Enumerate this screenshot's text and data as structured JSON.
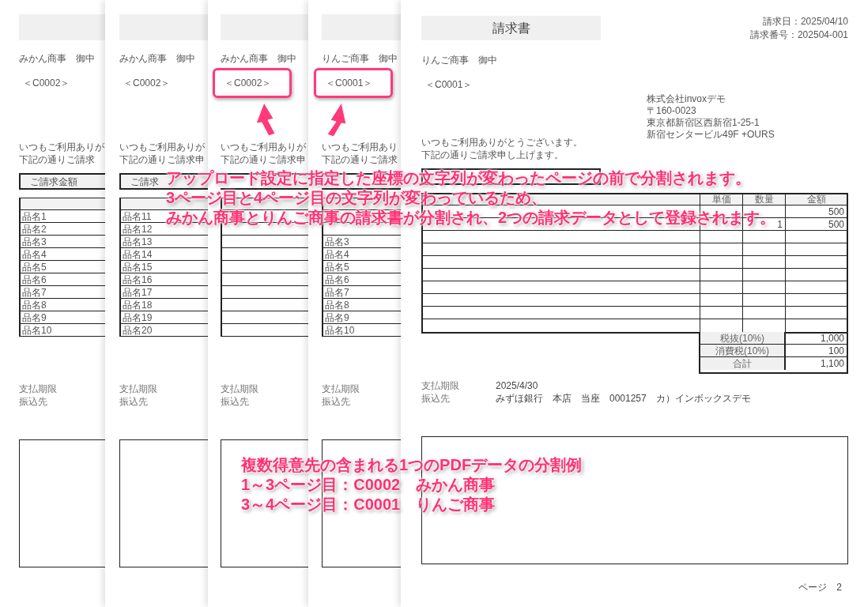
{
  "back_pages": [
    {
      "customer": "みかん商事　御中",
      "code": "＜C0002＞",
      "highlighted": false,
      "greeting": [
        "いつもご利用ありが",
        "下記の通りご請求"
      ],
      "amount_label": "ご請求金額",
      "rows": [
        {
          "kind": "item",
          "name": "品名1"
        },
        {
          "kind": "item",
          "name": "品名2"
        },
        {
          "kind": "item",
          "name": "品名3"
        },
        {
          "kind": "item",
          "name": "品名4"
        },
        {
          "kind": "item",
          "name": "品名5"
        },
        {
          "kind": "item",
          "name": "品名6"
        },
        {
          "kind": "item",
          "name": "品名7"
        },
        {
          "kind": "item",
          "name": "品名8"
        },
        {
          "kind": "item",
          "name": "品名9"
        },
        {
          "kind": "item",
          "name": "品名10"
        }
      ],
      "payment": [
        "支払期限",
        "振込先"
      ]
    },
    {
      "customer": "みかん商事　御中",
      "code": "＜C0002＞",
      "highlighted": false,
      "greeting": [
        "いつもご利用ありが",
        "下記の通りご請求申"
      ],
      "amount_label": "ご請求",
      "rows": [
        {
          "kind": "item",
          "name": "品名11"
        },
        {
          "kind": "item",
          "name": "品名12"
        },
        {
          "kind": "item",
          "name": "品名13"
        },
        {
          "kind": "item",
          "name": "品名14"
        },
        {
          "kind": "item",
          "name": "品名15"
        },
        {
          "kind": "item",
          "name": "品名16"
        },
        {
          "kind": "item",
          "name": "品名17"
        },
        {
          "kind": "item",
          "name": "品名18"
        },
        {
          "kind": "item",
          "name": "品名19"
        },
        {
          "kind": "item",
          "name": "品名20"
        }
      ],
      "payment": [
        "支払期限",
        "振込先"
      ]
    },
    {
      "customer": "みかん商事　御中",
      "code": "＜C0002＞",
      "highlighted": true,
      "greeting": [
        "いつもご利用ありが",
        "下記の通りご請求申"
      ],
      "payment": [
        "支払期限",
        "振込先"
      ]
    },
    {
      "customer": "りんご商事　御中",
      "code": "＜C0001＞",
      "highlighted": true,
      "greeting": [
        "いつもご利用あり",
        "下記の通りご請求"
      ],
      "rows": [
        {
          "kind": "covered"
        },
        {
          "kind": "covered"
        },
        {
          "kind": "item",
          "name": "品名3"
        },
        {
          "kind": "item",
          "name": "品名4"
        },
        {
          "kind": "item",
          "name": "品名5"
        },
        {
          "kind": "item",
          "name": "品名6"
        },
        {
          "kind": "item",
          "name": "品名7"
        },
        {
          "kind": "item",
          "name": "品名8"
        },
        {
          "kind": "item",
          "name": "品名9"
        },
        {
          "kind": "item",
          "name": "品名10"
        }
      ],
      "payment": [
        "支払期限",
        "振込先"
      ]
    }
  ],
  "front_page": {
    "title": "請求書",
    "date": "請求日：2025/04/10",
    "number": "請求番号：202504-001",
    "customer": "りんご商事　御中",
    "code": "＜C0001＞",
    "highlighted": false,
    "issuer": [
      "株式会社invoxデモ",
      "〒160-0023",
      "東京都新宿区西新宿1-25-1",
      "新宿センタービル49F +OURS"
    ],
    "greeting": [
      "いつもご利用ありがとうございます。",
      "下記の通りご請求申し上げます。"
    ],
    "columns": [
      "単価",
      "数量",
      "金額"
    ],
    "rows": [
      {
        "amount": "500"
      },
      {
        "quantity": "1",
        "amount": "500"
      }
    ],
    "summary": [
      {
        "label": "税抜(10%)",
        "value": "1,000"
      },
      {
        "label": "消費税(10%)",
        "value": "100"
      },
      {
        "label": "合計",
        "value": "1,100"
      }
    ],
    "payment": [
      {
        "label": "支払期限",
        "value": "2025/4/30"
      },
      {
        "label": "振込先",
        "value": "みずほ銀行　本店　当座　0001257　カ）インボックスデモ"
      }
    ],
    "footer": "ページ　2"
  },
  "notes": {
    "split_note": [
      "アップロード設定に指定した座標の文字列が変わったページの前で分割されます。",
      "3ページ目と4ページ目の文字列が変わっているため、",
      "みかん商事とりんご商事の請求書が分割され、2つの請求データとして登録されます。"
    ],
    "example_note": [
      "複数得意先の含まれる1つのPDFデータの分割例",
      "1～3ページ目：C0002　みかん商事",
      "3～4ページ目：C0001　りんご商事"
    ]
  }
}
